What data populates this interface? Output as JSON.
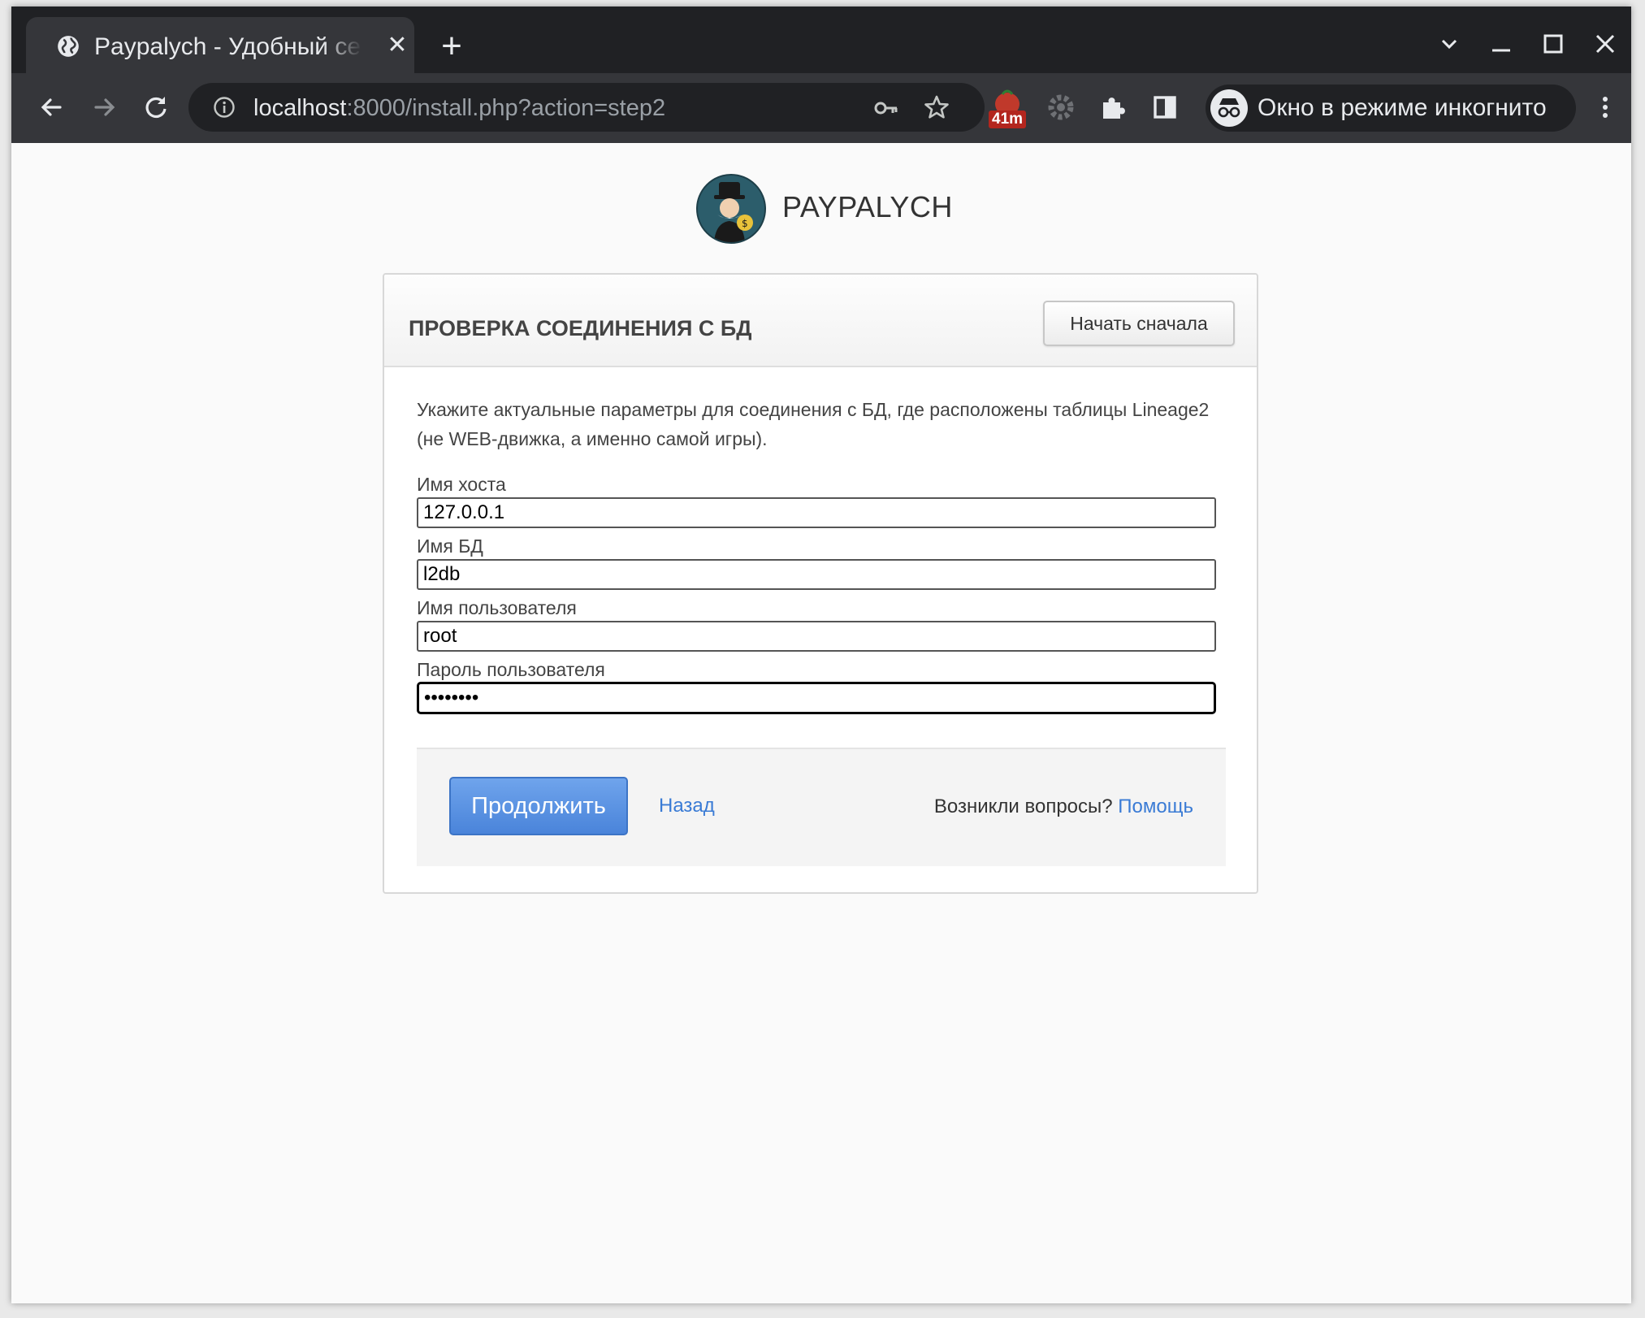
{
  "browser": {
    "tab_title": "Paypalych - Удобный сервис",
    "url_host": "localhost",
    "url_rest": ":8000/install.php?action=step2",
    "extension_badge": "41m",
    "incognito_label": "Окно в режиме инкогнито"
  },
  "page": {
    "brand_name": "PAYPALYCH",
    "card_title": "ПРОВЕРКА СОЕДИНЕНИЯ С БД",
    "restart_label": "Начать сначала",
    "intro_text": "Укажите актуальные параметры для соединения с БД, где расположены таблицы Lineage2 (не WEB-движка, а именно самой игры).",
    "fields": [
      {
        "label": "Имя хоста",
        "value": "127.0.0.1"
      },
      {
        "label": "Имя БД",
        "value": "l2db"
      },
      {
        "label": "Имя пользователя",
        "value": "root"
      },
      {
        "label": "Пароль пользователя",
        "value": "••••••••"
      }
    ],
    "continue_label": "Продолжить",
    "back_label": "Назад",
    "help_question": "Возникли вопросы?",
    "help_link": "Помощь"
  },
  "colors": {
    "accent": "#4a84da",
    "link": "#3a7bd5",
    "chrome_dark": "#202124",
    "chrome_toolbar": "#35363a",
    "extension_badge": "#b3261e"
  },
  "icons": [
    "globe-icon",
    "close-icon",
    "new-tab-icon",
    "tab-search-icon",
    "minimize-icon",
    "maximize-icon",
    "window-close-icon",
    "back-icon",
    "forward-icon",
    "reload-icon",
    "info-icon",
    "key-icon",
    "star-icon",
    "extension-timer-icon",
    "settings-gear-icon",
    "puzzle-icon",
    "side-panel-icon",
    "incognito-icon",
    "kebab-menu-icon"
  ]
}
